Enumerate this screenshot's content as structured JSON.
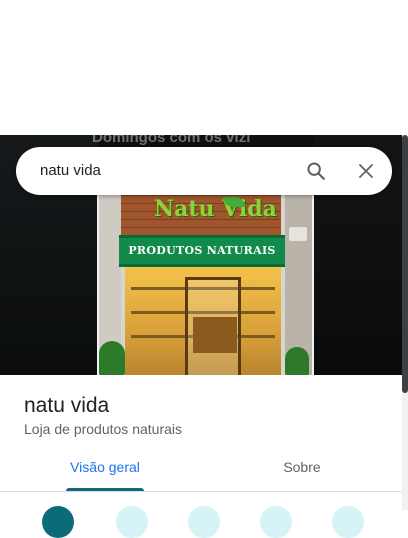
{
  "search": {
    "query": "natu vida"
  },
  "photo": {
    "overlay_caption": "Domingos com os vizi",
    "brand_logo": "Natu Vida",
    "store_sign": "PRODUTOS NATURAIS"
  },
  "place": {
    "name": "natu vida",
    "category": "Loja de produtos naturais"
  },
  "tabs": [
    {
      "label": "Visão geral",
      "selected": true
    },
    {
      "label": "Sobre",
      "selected": false
    }
  ],
  "colors": {
    "accent": "#0b6b78",
    "tab_active_text": "#1a73e8",
    "action_bg": "#d6f3f6"
  },
  "icons": {
    "search": "search-icon",
    "close": "close-icon"
  }
}
